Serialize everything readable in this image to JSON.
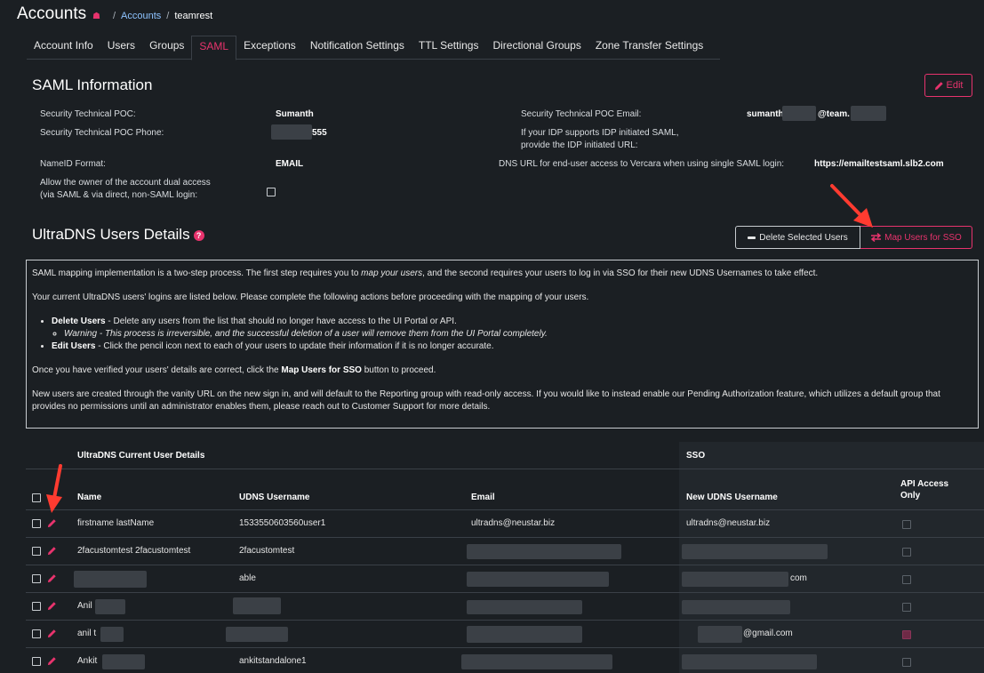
{
  "header": {
    "title": "Accounts",
    "breadcrumb": {
      "link": "Accounts",
      "current": "teamrest",
      "separator": "/"
    }
  },
  "tabs": [
    "Account Info",
    "Users",
    "Groups",
    "SAML",
    "Exceptions",
    "Notification Settings",
    "TTL Settings",
    "Directional Groups",
    "Zone Transfer Settings"
  ],
  "active_tab": "SAML",
  "saml": {
    "title": "SAML Information",
    "edit_label": "Edit",
    "fields": {
      "poc_label": "Security Technical POC:",
      "poc_value": "Sumanth",
      "poc_email_label": "Security Technical POC Email:",
      "poc_email_prefix": "sumanth",
      "poc_email_mid": "@team.",
      "poc_phone_label": "Security Technical POC Phone:",
      "poc_phone_suffix": "555",
      "idp_label_1": "If your IDP supports IDP initiated SAML,",
      "idp_label_2": "provide the IDP initiated URL:",
      "nameid_label": "NameID Format:",
      "nameid_value": "EMAIL",
      "dns_url_label": "DNS URL for end-user access to Vercara when using single SAML login:",
      "dns_url_value": "https://emailtestsaml.slb2.com",
      "dual_access_label_1": "Allow the owner of the account dual access",
      "dual_access_label_2": "(via SAML & via direct, non-SAML login:"
    }
  },
  "users_section": {
    "title": "UltraDNS Users Details",
    "delete_label": "Delete Selected Users",
    "map_label": "Map Users for SSO"
  },
  "info": {
    "p1_a": "SAML mapping implementation is a two-step process. The first step requires you to ",
    "p1_em": "map your users",
    "p1_b": ", and the second requires your users to log in via SSO for their new UDNS Usernames to take effect.",
    "p2": "Your current UltraDNS users' logins are listed below. Please complete the following actions before proceeding with the mapping of your users.",
    "b1_title": "Delete Users",
    "b1_text": " - Delete any users from the list that should no longer have access to the UI Portal or API.",
    "b1_warning": "Warning - This process is irreversible, and the successful deletion of a user will remove them from the UI Portal completely.",
    "b2_title": "Edit Users",
    "b2_text": " - Click the pencil icon next to each of your users to update their information if it is no longer accurate.",
    "p3_a": "Once you have verified your users' details are correct, click the ",
    "p3_b": "Map Users for SSO",
    "p3_c": " button to proceed.",
    "p4": "New users are created through the vanity URL on the new sign in, and will default to the Reporting group with read-only access. If you would like to instead enable our Pending Authorization feature, which utilizes a default group that provides no permissions until an administrator enables them, please reach out to Customer Support for more details."
  },
  "table": {
    "group_current": "UltraDNS Current User Details",
    "group_sso": "SSO",
    "col_name": "Name",
    "col_udns": "UDNS Username",
    "col_email": "Email",
    "col_new_udns": "New UDNS Username",
    "col_api_1": "API Access",
    "col_api_2": "Only",
    "rows": [
      {
        "name": "firstname lastName",
        "udns": "1533550603560user1",
        "email": "ultradns@neustar.biz",
        "new_udns": "ultradns@neustar.biz",
        "api_only": false
      },
      {
        "name": "2facustomtest 2facustomtest",
        "udns": "2facustomtest",
        "email": "",
        "new_udns": "",
        "api_only": false
      },
      {
        "name": "",
        "udns": "able",
        "email": "",
        "new_udns": "com",
        "api_only": false
      },
      {
        "name": "Anil",
        "udns": "",
        "email": "",
        "new_udns": "",
        "api_only": false
      },
      {
        "name": "anil t",
        "udns": "",
        "email": "",
        "new_udns": "@gmail.com",
        "api_only": true
      },
      {
        "name": "Ankit",
        "udns": "ankitstandalone1",
        "email": "",
        "new_udns": "",
        "api_only": false
      }
    ]
  },
  "colors": {
    "accent": "#e8336d",
    "link": "#8ec3ff",
    "background": "#1b1f23",
    "annotation_arrow": "#ff3b30"
  }
}
